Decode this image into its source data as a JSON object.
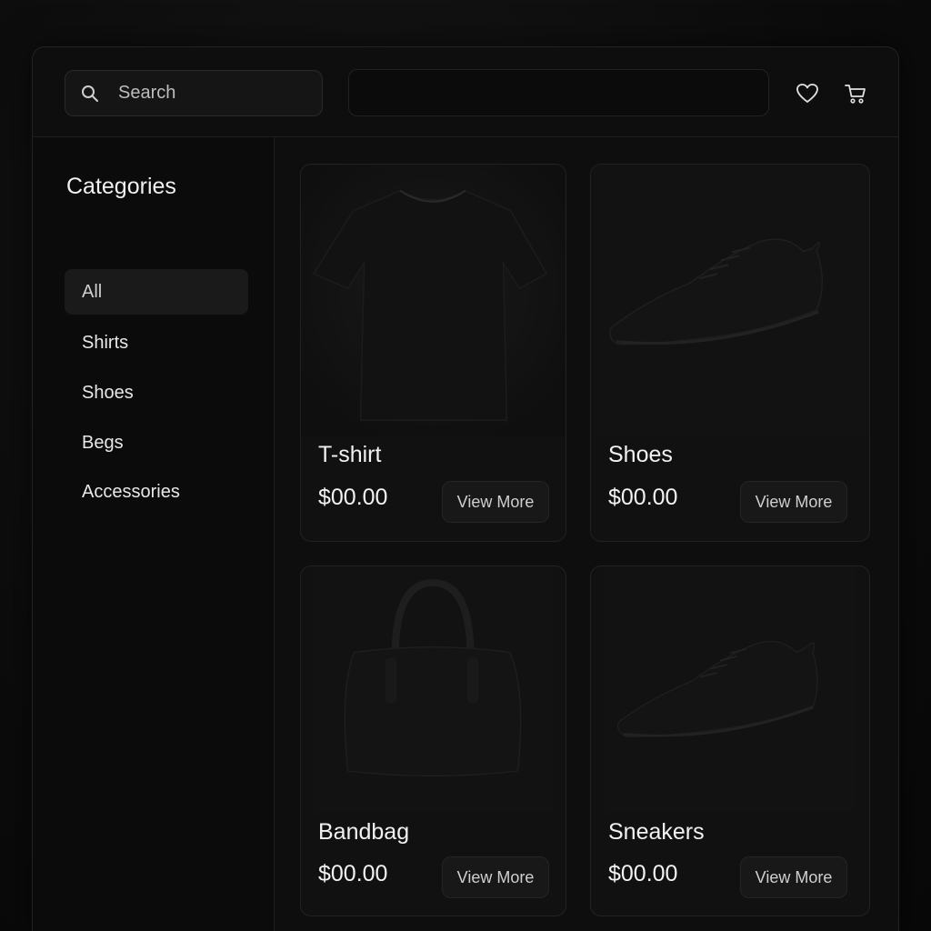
{
  "header": {
    "search_placeholder": "Search"
  },
  "sidebar": {
    "title": "Categories",
    "items": [
      {
        "label": "All",
        "active": true
      },
      {
        "label": "Shirts",
        "active": false
      },
      {
        "label": "Shoes",
        "active": false
      },
      {
        "label": "Begs",
        "active": false
      },
      {
        "label": "Accessories",
        "active": false
      }
    ]
  },
  "products": [
    {
      "name": "T-shirt",
      "price": "$00.00",
      "button": "View More",
      "icon": "tshirt-image"
    },
    {
      "name": "Shoes",
      "price": "$00.00",
      "button": "View More",
      "icon": "shoe-image"
    },
    {
      "name": "Bandbag",
      "price": "$00.00",
      "button": "View More",
      "icon": "handbag-image"
    },
    {
      "name": "Sneakers",
      "price": "$00.00",
      "button": "View More",
      "icon": "sneaker-image"
    }
  ],
  "colors": {
    "background": "#0c0c0c",
    "panel": "#0e0e0e",
    "text": "#f0f0f0"
  }
}
